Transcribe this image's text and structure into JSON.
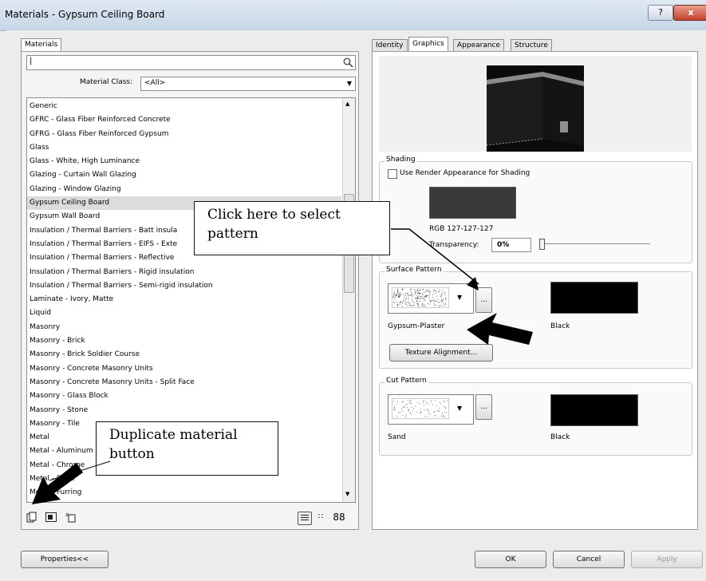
{
  "window": {
    "title": "Materials - Gypsum Ceiling Board",
    "help_label": "?",
    "close_label": "x"
  },
  "left": {
    "tab_label": "Materials",
    "search_value": "|",
    "material_class_label": "Material Class:",
    "material_class_value": "<All>",
    "items": [
      "Generic",
      "GFRC - Glass Fiber Reinforced Concrete",
      "GFRG - Glass Fiber Reinforced Gypsum",
      "Glass",
      "Glass - White, High Luminance",
      "Glazing - Curtain Wall Glazing",
      "Glazing - Window Glazing",
      "Gypsum Ceiling Board",
      "Gypsum Wall Board",
      "Insulation / Thermal Barriers - Batt insula",
      "Insulation / Thermal Barriers - EIFS - Exte",
      "Insulation / Thermal Barriers - Reflective",
      "Insulation / Thermal Barriers - Rigid insulation",
      "Insulation / Thermal Barriers - Semi-rigid insulation",
      "Laminate - Ivory, Matte",
      "Liquid",
      "Masonry",
      "Masonry - Brick",
      "Masonry - Brick Soldier Course",
      "Masonry - Concrete Masonry Units",
      "Masonry - Concrete Masonry Units - Split Face",
      "Masonry - Glass Block",
      "Masonry - Stone",
      "Masonry - Tile",
      "Metal",
      "Metal - Aluminum",
      "Metal - Chrome",
      "Metal - Deck",
      "Metal - Furring"
    ],
    "selected_index": 7
  },
  "right": {
    "tabs": [
      "Identity",
      "Graphics",
      "Appearance",
      "Structure"
    ],
    "active_tab": "Graphics",
    "shading": {
      "legend": "Shading",
      "checkbox_label": "Use Render Appearance for Shading",
      "color_label": "RGB 127-127-127",
      "color": "#3a3a3a",
      "transparency_label": "Transparency:",
      "transparency_value": "0%"
    },
    "surface_pattern": {
      "legend": "Surface Pattern",
      "pattern_name": "Gypsum-Plaster",
      "color_name": "Black",
      "ellipsis_label": "...",
      "texture_button": "Texture Alignment..."
    },
    "cut_pattern": {
      "legend": "Cut Pattern",
      "pattern_name": "Sand",
      "color_name": "Black",
      "ellipsis_label": "..."
    }
  },
  "callouts": {
    "select_pattern": "Click here to select pattern",
    "duplicate": "Duplicate material button"
  },
  "buttons": {
    "properties": "Properties<<",
    "ok": "OK",
    "cancel": "Cancel",
    "apply": "Apply"
  }
}
